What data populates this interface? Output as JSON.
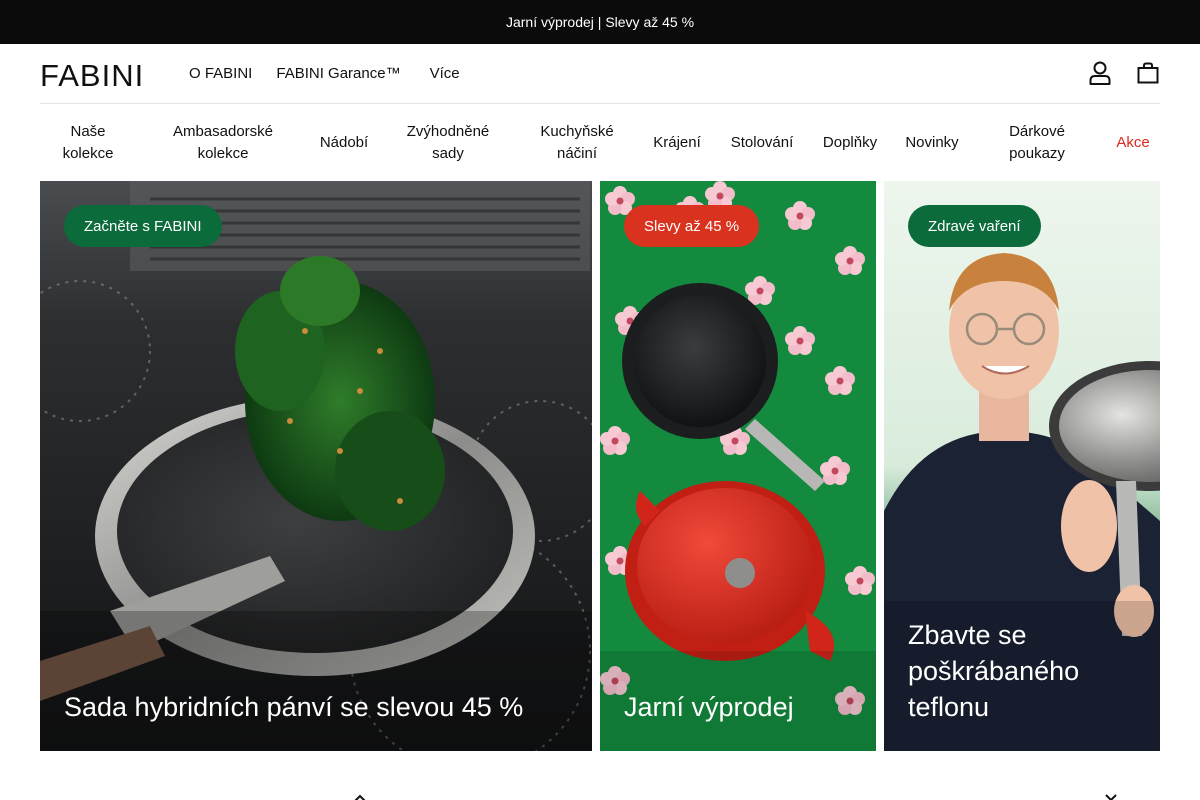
{
  "promo": {
    "text": "Jarní výprodej | Slevy až 45 %"
  },
  "header": {
    "logo": "FABINI",
    "links": [
      "O FABINI",
      "FABINI Garance™",
      "Více"
    ],
    "icons": [
      "user-icon",
      "shopping-bag-icon"
    ]
  },
  "categories": [
    "Naše kolekce",
    "Ambasadorské kolekce",
    "Nádobí",
    "Zvýhodněné sady",
    "Kuchyňské náčiní",
    "Krájení",
    "Stolování",
    "Doplňky",
    "Novinky",
    "Dárkové poukazy",
    "Akce"
  ],
  "banners": [
    {
      "badge": "Začněte s FABINI",
      "title": "Sada hybridních pánví se slevou 45 %",
      "badge_color": "#0b6b3a"
    },
    {
      "badge": "Slevy až 45 %",
      "title": "Jarní výprodej",
      "badge_color": "#d9331f"
    },
    {
      "badge": "Zdravé vaření",
      "title": "Zbavte se poškrábaného teflonu",
      "badge_color": "#0b6b3a"
    }
  ],
  "colors": {
    "accent_green": "#0b6b3a",
    "sale_red": "#e0291d",
    "promo_bg": "#0b0b0b"
  }
}
